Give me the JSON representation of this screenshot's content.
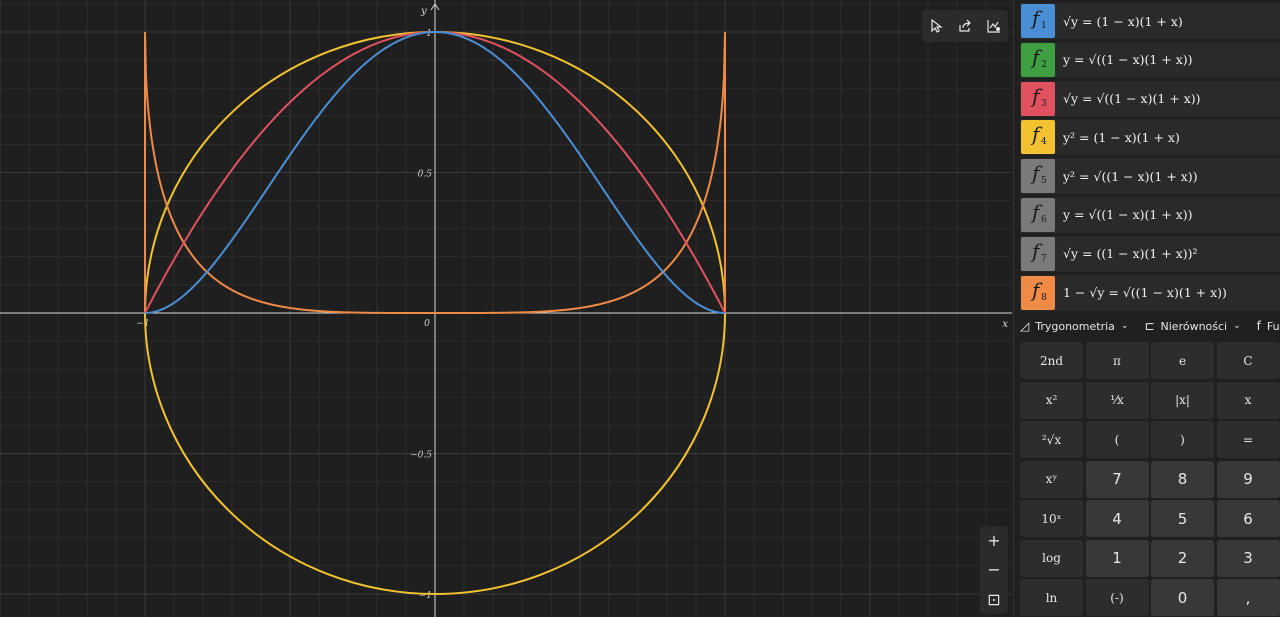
{
  "graph": {
    "axis_x_label": "x",
    "axis_y_label": "y",
    "x_ticks": [
      "−1",
      "0"
    ],
    "y_ticks": [
      "1",
      "0.5",
      "−0.5",
      "−1"
    ],
    "view_x_range": [
      -1.5,
      1.98
    ],
    "view_y_range": [
      -1.08,
      1.1
    ],
    "colors": {
      "f1": "#4a8fd6",
      "f3": "#e05260",
      "f4": "#f2c230",
      "f8": "#ef8a47"
    }
  },
  "toolbar": {
    "icons": [
      "cursor-icon",
      "share-icon",
      "graph-settings-icon"
    ]
  },
  "zoom": {
    "in_glyph": "+",
    "out_glyph": "−",
    "reset_glyph": "⊡"
  },
  "functions": [
    {
      "id": "1",
      "letter": "f",
      "color": "#4a8fd6",
      "formula": "√y = (1 − x)(1 + x)"
    },
    {
      "id": "2",
      "letter": "f",
      "color": "#3fa043",
      "formula": "y = √((1 − x)(1 + x))"
    },
    {
      "id": "3",
      "letter": "f",
      "color": "#e05260",
      "formula": "√y = √((1 − x)(1 + x))"
    },
    {
      "id": "4",
      "letter": "f",
      "color": "#f2c230",
      "formula": "y² = (1 − x)(1 + x)"
    },
    {
      "id": "5",
      "letter": "f",
      "color": "#7a7a7a",
      "formula": "y² = √((1 − x)(1 + x))"
    },
    {
      "id": "6",
      "letter": "f",
      "color": "#7a7a7a",
      "formula": "y = √((1 − x)(1 + x))"
    },
    {
      "id": "7",
      "letter": "f",
      "color": "#7a7a7a",
      "formula": "√y = ((1 − x)(1 + x))²"
    },
    {
      "id": "8",
      "letter": "f",
      "color": "#ef8a47",
      "formula": "1 − √y = √((1 − x)(1 + x))"
    }
  ],
  "categories": [
    {
      "icon": "◿",
      "label": "Trygonometria"
    },
    {
      "icon": "⊏",
      "label": "Nierówności"
    },
    {
      "icon": "f",
      "label": "Funkcje"
    }
  ],
  "keypad": [
    {
      "label": "2nd",
      "kind": "fn"
    },
    {
      "label": "π",
      "kind": "fn"
    },
    {
      "label": "e",
      "kind": "fn"
    },
    {
      "label": "C",
      "kind": "fn"
    },
    {
      "label": "x²",
      "kind": "fn"
    },
    {
      "label": "¹⁄x",
      "kind": "fn"
    },
    {
      "label": "|x|",
      "kind": "fn"
    },
    {
      "label": "x",
      "kind": "fn"
    },
    {
      "label": "²√x",
      "kind": "fn"
    },
    {
      "label": "(",
      "kind": "fn"
    },
    {
      "label": ")",
      "kind": "fn"
    },
    {
      "label": "=",
      "kind": "fn"
    },
    {
      "label": "xʸ",
      "kind": "fn"
    },
    {
      "label": "7",
      "kind": "num"
    },
    {
      "label": "8",
      "kind": "num"
    },
    {
      "label": "9",
      "kind": "num"
    },
    {
      "label": "10ˣ",
      "kind": "fn"
    },
    {
      "label": "4",
      "kind": "num"
    },
    {
      "label": "5",
      "kind": "num"
    },
    {
      "label": "6",
      "kind": "num"
    },
    {
      "label": "log",
      "kind": "fn"
    },
    {
      "label": "1",
      "kind": "num"
    },
    {
      "label": "2",
      "kind": "num"
    },
    {
      "label": "3",
      "kind": "num"
    },
    {
      "label": "ln",
      "kind": "fn"
    },
    {
      "label": "(-)",
      "kind": "fn"
    },
    {
      "label": "0",
      "kind": "num"
    },
    {
      "label": ",",
      "kind": "num"
    }
  ]
}
